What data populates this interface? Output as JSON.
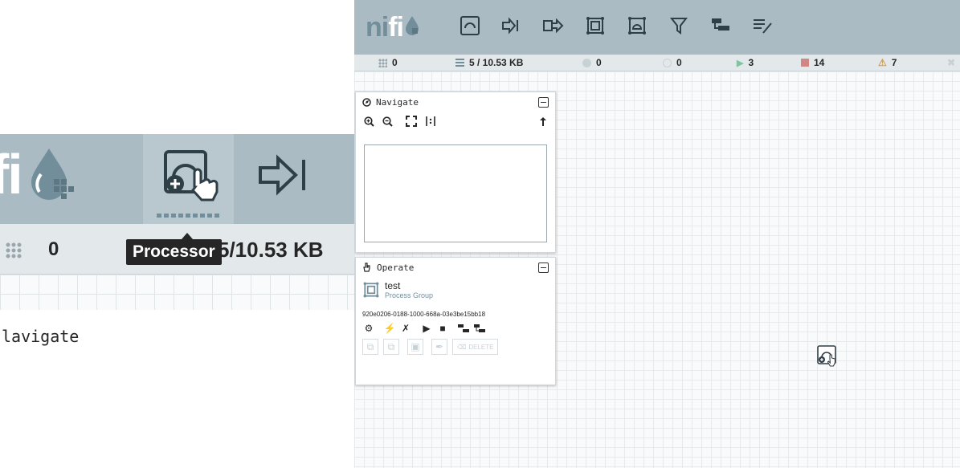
{
  "brand": {
    "logo_text_ni": "ni",
    "logo_text_fi": "fi"
  },
  "toolbar": {
    "items": [
      {
        "name": "processor-icon"
      },
      {
        "name": "input-port-icon"
      },
      {
        "name": "output-port-icon"
      },
      {
        "name": "process-group-icon"
      },
      {
        "name": "remote-process-group-icon"
      },
      {
        "name": "funnel-icon"
      },
      {
        "name": "template-icon"
      },
      {
        "name": "label-icon"
      }
    ]
  },
  "status": {
    "active_threads": "0",
    "queued": "5 / 10.53 KB",
    "transmitting": "0",
    "not_transmitting": "0",
    "running": "3",
    "stopped": "14",
    "invalid": "7"
  },
  "navigate": {
    "title": "Navigate"
  },
  "operate": {
    "title": "Operate",
    "selection_name": "test",
    "selection_type": "Process Group",
    "selection_id": "920e0206-0188-1000-668a-03e3be15bb18",
    "delete_label": "DELETE"
  },
  "zoom": {
    "stat_threads": "0",
    "stat_queued_partial": "5/10.53 KB",
    "tooltip": "Processor",
    "panel_label": "Navigate",
    "panel_label_visible": "lavigate"
  },
  "colors": {
    "header": "#aabbc3",
    "statusbar": "#e3e8eb",
    "dark": "#262626",
    "accent": "#728e9b",
    "running": "#7dc7a0",
    "stopped": "#d18686",
    "invalid": "#cf9f5d"
  }
}
